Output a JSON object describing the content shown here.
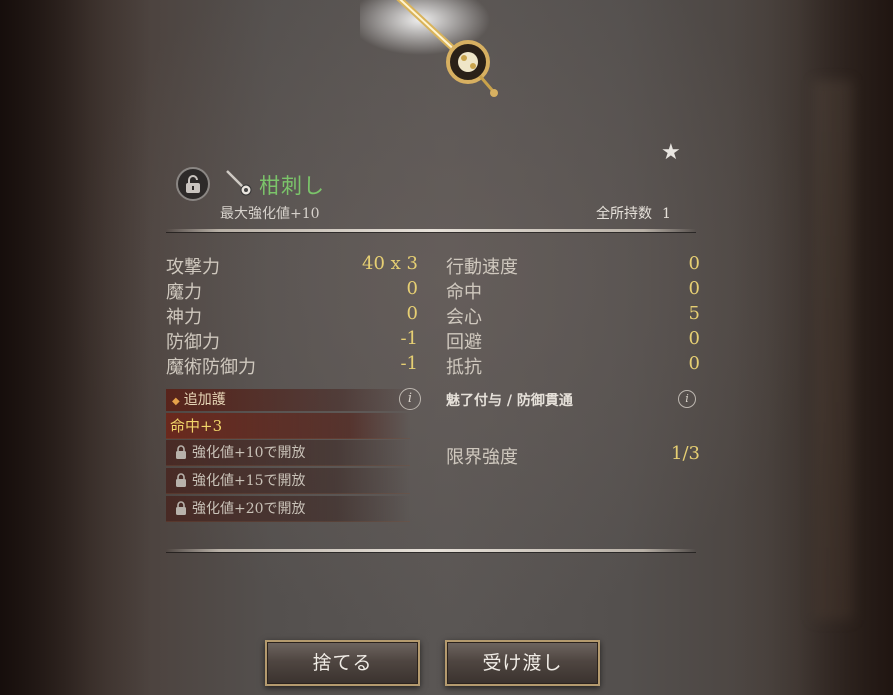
{
  "item": {
    "name": "柑刺し",
    "max_enhance": "最大強化値+10",
    "owned_label": "全所持数",
    "owned_count": "1"
  },
  "stats_left": [
    {
      "label": "攻撃力",
      "value": "40 x 3"
    },
    {
      "label": "魔力",
      "value": "0"
    },
    {
      "label": "神力",
      "value": "0"
    },
    {
      "label": "防御力",
      "value": "-1"
    },
    {
      "label": "魔術防御力",
      "value": "-1"
    }
  ],
  "stats_right": [
    {
      "label": "行動速度",
      "value": "0"
    },
    {
      "label": "命中",
      "value": "0"
    },
    {
      "label": "会心",
      "value": "5"
    },
    {
      "label": "回避",
      "value": "0"
    },
    {
      "label": "抵抗",
      "value": "0"
    }
  ],
  "extra": {
    "header": "追加護",
    "active": "命中+3",
    "locked": [
      "強化値+10で開放",
      "強化値+15で開放",
      "強化値+20で開放"
    ]
  },
  "charm_label": "魅了付与 / 防御貫通",
  "limit": {
    "label": "限界強度",
    "value": "1/3"
  },
  "buttons": {
    "discard": "捨てる",
    "transfer": "受け渡し"
  },
  "icons": {
    "lock": "padlock-open-icon",
    "item": "hairpin-icon",
    "favorite": "star-icon",
    "info": "info-icon"
  },
  "colors": {
    "item_name": "#7bc46a",
    "stat_value": "#e6cf73",
    "active_bonus": "#f2d66a"
  }
}
